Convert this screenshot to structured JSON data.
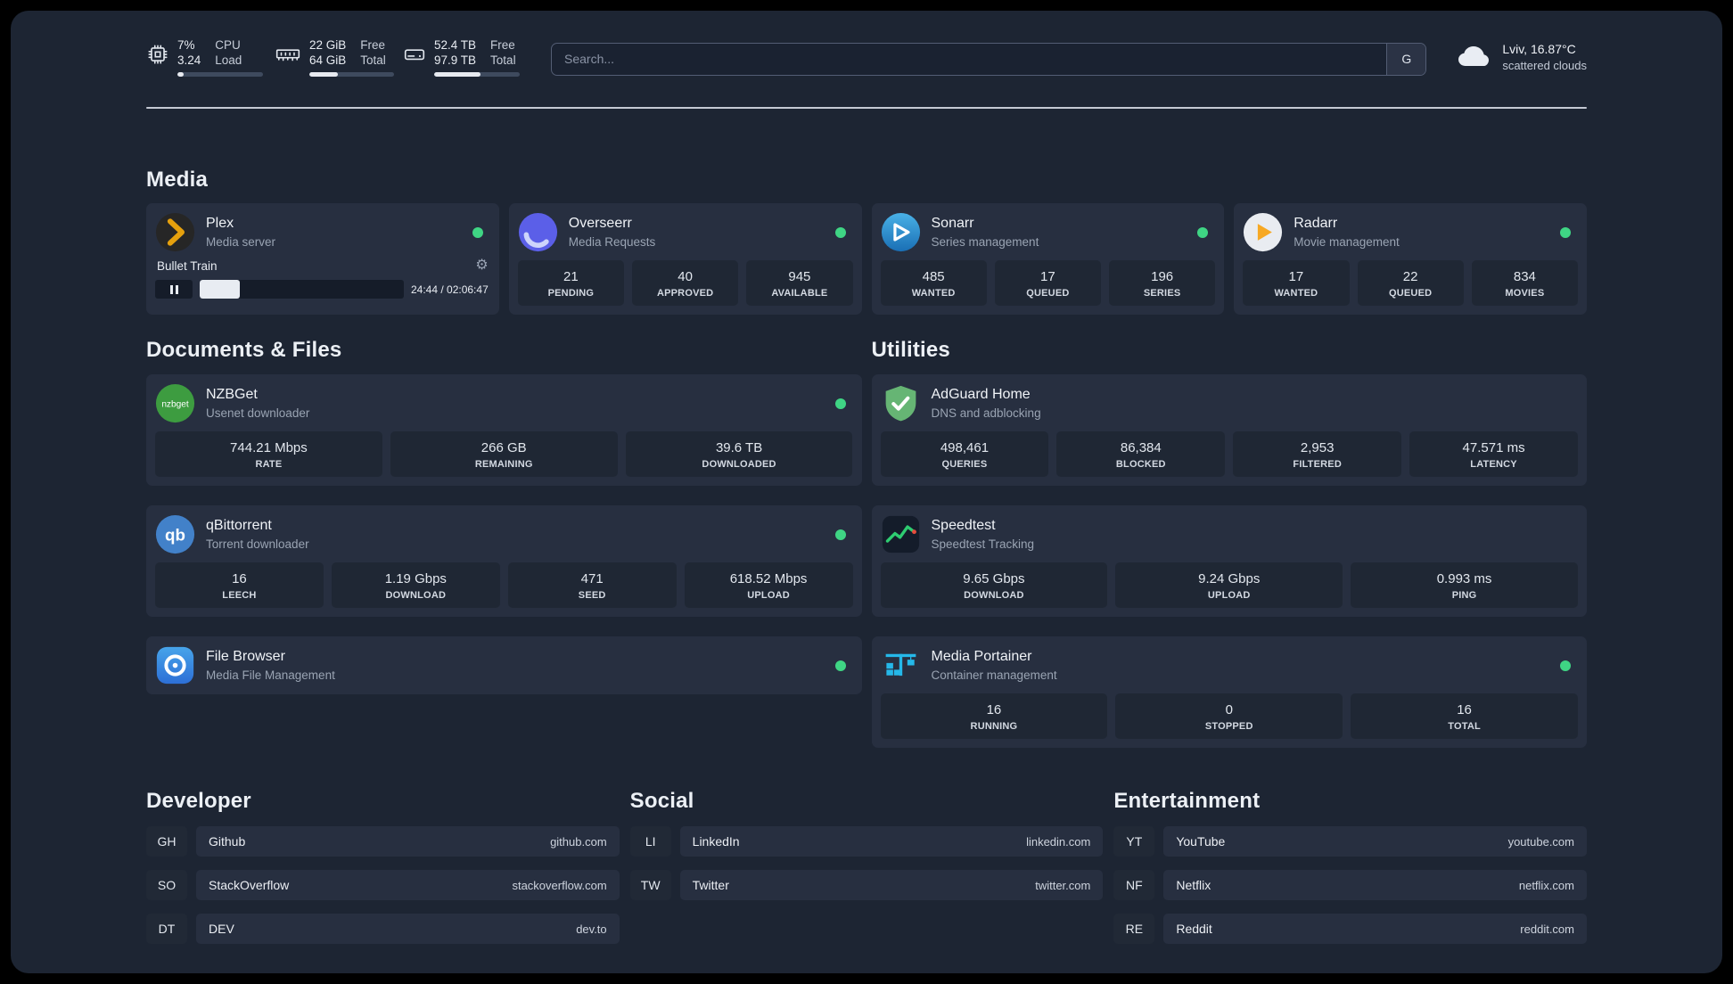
{
  "topbar": {
    "cpu": {
      "value1": "7%",
      "value2": "3.24",
      "label1": "CPU",
      "label2": "Load",
      "bar_percent": 7
    },
    "memory": {
      "value1": "22 GiB",
      "value2": "64 GiB",
      "label1": "Free",
      "label2": "Total",
      "bar_percent": 34
    },
    "disk": {
      "value1": "52.4 TB",
      "value2": "97.9 TB",
      "label1": "Free",
      "label2": "Total",
      "bar_percent": 54
    },
    "search": {
      "placeholder": "Search...",
      "button": "G"
    },
    "weather": {
      "location": "Lviv, 16.87°C",
      "condition": "scattered clouds"
    }
  },
  "colors": {
    "status_online": "#3fd584"
  },
  "sections": {
    "media": {
      "title": "Media",
      "cards": [
        {
          "name": "Plex",
          "subtitle": "Media server",
          "icon": "plex-icon",
          "online": true,
          "widget": {
            "track": "Bullet Train",
            "time": "24:44 / 02:06:47",
            "progress_percent": 19.5
          }
        },
        {
          "name": "Overseerr",
          "subtitle": "Media Requests",
          "icon": "overseerr-icon",
          "online": true,
          "stats": [
            {
              "value": "21",
              "label": "PENDING"
            },
            {
              "value": "40",
              "label": "APPROVED"
            },
            {
              "value": "945",
              "label": "AVAILABLE"
            }
          ]
        },
        {
          "name": "Sonarr",
          "subtitle": "Series management",
          "icon": "sonarr-icon",
          "online": true,
          "stats": [
            {
              "value": "485",
              "label": "WANTED"
            },
            {
              "value": "17",
              "label": "QUEUED"
            },
            {
              "value": "196",
              "label": "SERIES"
            }
          ]
        },
        {
          "name": "Radarr",
          "subtitle": "Movie management",
          "icon": "radarr-icon",
          "online": true,
          "stats": [
            {
              "value": "17",
              "label": "WANTED"
            },
            {
              "value": "22",
              "label": "QUEUED"
            },
            {
              "value": "834",
              "label": "MOVIES"
            }
          ]
        }
      ]
    },
    "documents": {
      "title": "Documents & Files",
      "cards": [
        {
          "name": "NZBGet",
          "subtitle": "Usenet downloader",
          "icon": "nzbget-icon",
          "online": true,
          "stats": [
            {
              "value": "744.21 Mbps",
              "label": "RATE"
            },
            {
              "value": "266 GB",
              "label": "REMAINING"
            },
            {
              "value": "39.6 TB",
              "label": "DOWNLOADED"
            }
          ]
        },
        {
          "name": "qBittorrent",
          "subtitle": "Torrent downloader",
          "icon": "qbittorrent-icon",
          "online": true,
          "stats": [
            {
              "value": "16",
              "label": "LEECH"
            },
            {
              "value": "1.19 Gbps",
              "label": "DOWNLOAD"
            },
            {
              "value": "471",
              "label": "SEED"
            },
            {
              "value": "618.52 Mbps",
              "label": "UPLOAD"
            }
          ]
        },
        {
          "name": "File Browser",
          "subtitle": "Media File Management",
          "icon": "filebrowser-icon",
          "online": true
        }
      ]
    },
    "utilities": {
      "title": "Utilities",
      "cards": [
        {
          "name": "AdGuard Home",
          "subtitle": "DNS and adblocking",
          "icon": "adguard-icon",
          "stats": [
            {
              "value": "498,461",
              "label": "QUERIES"
            },
            {
              "value": "86,384",
              "label": "BLOCKED"
            },
            {
              "value": "2,953",
              "label": "FILTERED"
            },
            {
              "value": "47.571 ms",
              "label": "LATENCY"
            }
          ]
        },
        {
          "name": "Speedtest",
          "subtitle": "Speedtest Tracking",
          "icon": "speedtest-icon",
          "stats": [
            {
              "value": "9.65 Gbps",
              "label": "DOWNLOAD"
            },
            {
              "value": "9.24 Gbps",
              "label": "UPLOAD"
            },
            {
              "value": "0.993 ms",
              "label": "PING"
            }
          ]
        },
        {
          "name": "Media Portainer",
          "subtitle": "Container management",
          "icon": "portainer-icon",
          "online": true,
          "stats": [
            {
              "value": "16",
              "label": "RUNNING"
            },
            {
              "value": "0",
              "label": "STOPPED"
            },
            {
              "value": "16",
              "label": "TOTAL"
            }
          ]
        }
      ]
    },
    "bookmarks": [
      {
        "title": "Developer",
        "items": [
          {
            "abbr": "GH",
            "name": "Github",
            "url": "github.com"
          },
          {
            "abbr": "SO",
            "name": "StackOverflow",
            "url": "stackoverflow.com"
          },
          {
            "abbr": "DT",
            "name": "DEV",
            "url": "dev.to"
          }
        ]
      },
      {
        "title": "Social",
        "items": [
          {
            "abbr": "LI",
            "name": "LinkedIn",
            "url": "linkedin.com"
          },
          {
            "abbr": "TW",
            "name": "Twitter",
            "url": "twitter.com"
          }
        ]
      },
      {
        "title": "Entertainment",
        "items": [
          {
            "abbr": "YT",
            "name": "YouTube",
            "url": "youtube.com"
          },
          {
            "abbr": "NF",
            "name": "Netflix",
            "url": "netflix.com"
          },
          {
            "abbr": "RE",
            "name": "Reddit",
            "url": "reddit.com"
          }
        ]
      }
    ]
  }
}
